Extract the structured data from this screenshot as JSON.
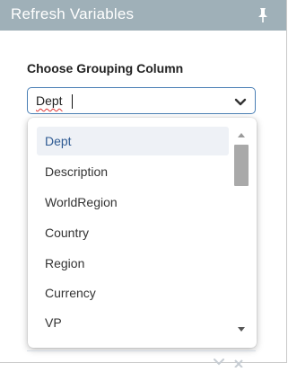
{
  "panel": {
    "title": "Refresh Variables",
    "pin_icon": "pin-icon"
  },
  "grouping": {
    "label": "Choose Grouping Column",
    "selected_value": "Dept",
    "dropdown_icon": "chevron-down-icon",
    "options": [
      {
        "label": "Dept",
        "selected": true
      },
      {
        "label": "Description",
        "selected": false
      },
      {
        "label": "WorldRegion",
        "selected": false
      },
      {
        "label": "Country",
        "selected": false
      },
      {
        "label": "Region",
        "selected": false
      },
      {
        "label": "Currency",
        "selected": false
      },
      {
        "label": "VP",
        "selected": false
      }
    ]
  },
  "colors": {
    "header_bg": "#9fb0b8",
    "select_border": "#4a7fb5",
    "selected_option_bg": "#eef1f6",
    "selected_option_text": "#2f5b93"
  }
}
